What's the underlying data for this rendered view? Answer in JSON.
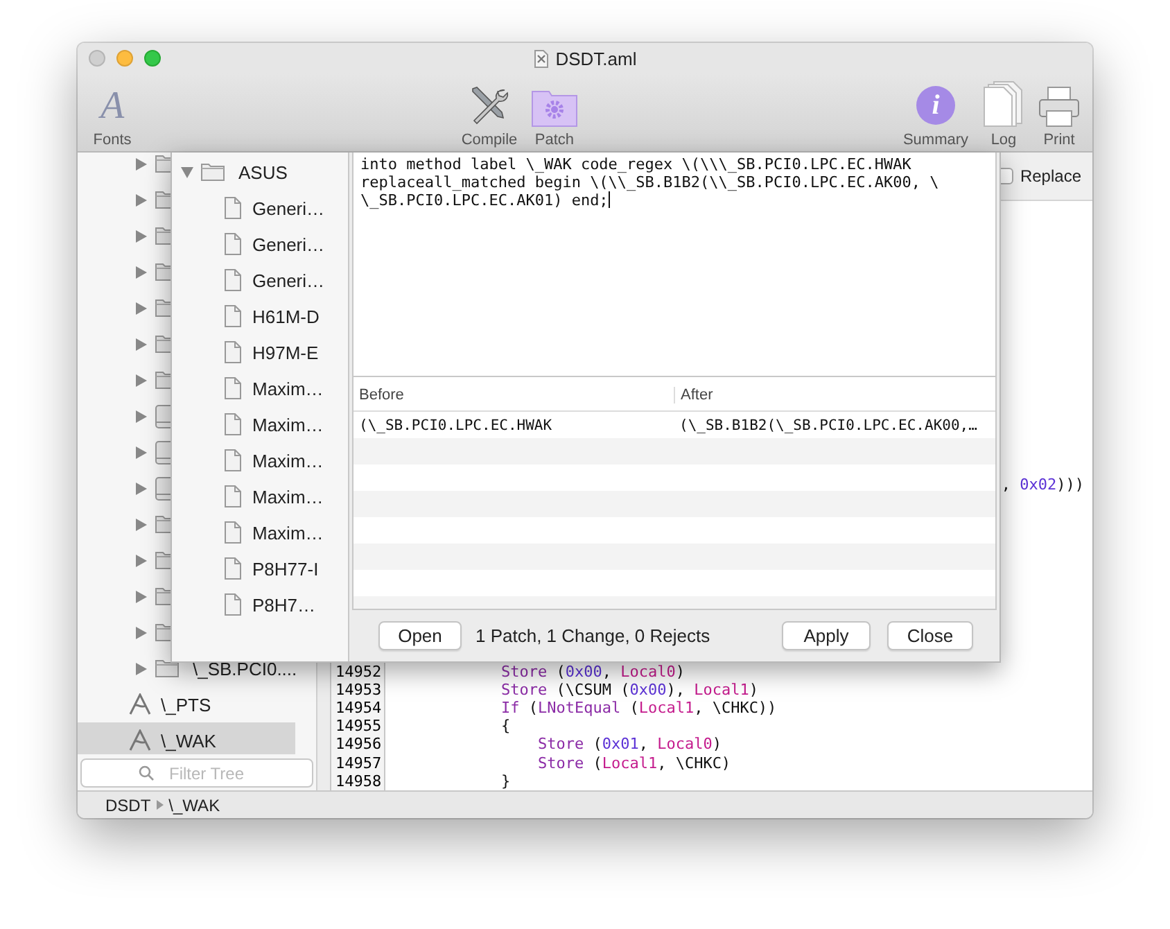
{
  "window": {
    "title": "DSDT.aml"
  },
  "toolbar": [
    {
      "label": "Fonts",
      "kind": "fonts",
      "glyph": "A"
    },
    {
      "label": "Compile",
      "kind": "compile"
    },
    {
      "label": "Patch",
      "kind": "patch"
    },
    {
      "label": "Summary",
      "kind": "summary",
      "glyph": "i"
    },
    {
      "label": "Log",
      "kind": "log"
    },
    {
      "label": "Print",
      "kind": "print"
    }
  ],
  "sidebar": {
    "items": [
      {
        "kind": "folder",
        "expanded": false,
        "selected": false
      },
      {
        "kind": "folder",
        "expanded": false,
        "selected": false
      },
      {
        "kind": "folder",
        "expanded": false,
        "selected": false
      },
      {
        "kind": "folder",
        "expanded": false,
        "selected": false
      },
      {
        "kind": "folder",
        "expanded": false,
        "selected": false
      },
      {
        "kind": "folder",
        "expanded": false,
        "selected": false
      },
      {
        "kind": "folder",
        "expanded": false,
        "selected": false
      },
      {
        "kind": "drive",
        "expanded": false,
        "selected": false
      },
      {
        "kind": "drive",
        "expanded": false,
        "selected": false
      },
      {
        "kind": "drive",
        "expanded": false,
        "selected": false
      },
      {
        "kind": "folder",
        "expanded": false,
        "selected": false
      },
      {
        "kind": "folder",
        "expanded": false,
        "selected": false
      },
      {
        "kind": "folder",
        "expanded": false,
        "selected": false
      },
      {
        "kind": "folder",
        "expanded": false,
        "selected": false
      },
      {
        "kind": "folder",
        "label": "\\_SB.PCI0....",
        "expanded": false,
        "selected": false
      },
      {
        "kind": "method",
        "label": "\\_PTS",
        "selected": false
      },
      {
        "kind": "method",
        "label": "\\_WAK",
        "selected": true
      }
    ],
    "filter": {
      "placeholder": "Filter Tree"
    }
  },
  "editor": {
    "replace": {
      "label": "Replace",
      "checked": false
    },
    "fragment": [
      {
        "text": ", ",
        "kind": "plain"
      },
      {
        "text": "0x02",
        "kind": "number"
      },
      {
        "text": ")))",
        "kind": "plain"
      }
    ],
    "lines": [
      {
        "number": "14952",
        "tokens": [
          {
            "text": "            Store",
            "kind": "keyword"
          },
          {
            "text": " (",
            "kind": "plain"
          },
          {
            "text": "0x00",
            "kind": "number"
          },
          {
            "text": ", ",
            "kind": "plain"
          },
          {
            "text": "Local0",
            "kind": "local"
          },
          {
            "text": ")",
            "kind": "plain"
          }
        ]
      },
      {
        "number": "14953",
        "tokens": [
          {
            "text": "            Store",
            "kind": "keyword"
          },
          {
            "text": " (\\CSUM (",
            "kind": "plain"
          },
          {
            "text": "0x00",
            "kind": "number"
          },
          {
            "text": "), ",
            "kind": "plain"
          },
          {
            "text": "Local1",
            "kind": "local"
          },
          {
            "text": ")",
            "kind": "plain"
          }
        ]
      },
      {
        "number": "14954",
        "tokens": [
          {
            "text": "            If",
            "kind": "keyword"
          },
          {
            "text": " (",
            "kind": "plain"
          },
          {
            "text": "LNotEqual",
            "kind": "keyword"
          },
          {
            "text": " (",
            "kind": "plain"
          },
          {
            "text": "Local1",
            "kind": "local"
          },
          {
            "text": ", \\CHKC))",
            "kind": "plain"
          }
        ]
      },
      {
        "number": "14955",
        "tokens": [
          {
            "text": "            {",
            "kind": "plain"
          }
        ]
      },
      {
        "number": "14956",
        "tokens": [
          {
            "text": "                Store",
            "kind": "keyword"
          },
          {
            "text": " (",
            "kind": "plain"
          },
          {
            "text": "0x01",
            "kind": "number"
          },
          {
            "text": ", ",
            "kind": "plain"
          },
          {
            "text": "Local0",
            "kind": "local"
          },
          {
            "text": ")",
            "kind": "plain"
          }
        ]
      },
      {
        "number": "14957",
        "tokens": [
          {
            "text": "                Store",
            "kind": "keyword"
          },
          {
            "text": " (",
            "kind": "plain"
          },
          {
            "text": "Local1",
            "kind": "local"
          },
          {
            "text": ", \\CHKC)",
            "kind": "plain"
          }
        ]
      },
      {
        "number": "14958",
        "tokens": [
          {
            "text": "            }",
            "kind": "plain"
          }
        ]
      }
    ]
  },
  "status_bar": {
    "path": [
      "DSDT",
      "\\_WAK"
    ]
  },
  "patch_sheet": {
    "library": {
      "label": "ASUS",
      "expanded": true,
      "children": [
        {
          "label": "Generi…"
        },
        {
          "label": "Generi…"
        },
        {
          "label": "Generi…"
        },
        {
          "label": "H61M-D"
        },
        {
          "label": "H97M-E"
        },
        {
          "label": "Maxim…"
        },
        {
          "label": "Maxim…"
        },
        {
          "label": "Maxim…"
        },
        {
          "label": "Maxim…"
        },
        {
          "label": "Maxim…"
        },
        {
          "label": "P8H77-I"
        },
        {
          "label": "P8H7…"
        }
      ]
    },
    "patch_text": [
      "into method label \\_WAK code_regex \\(\\\\\\_SB.PCI0.LPC.EC.HWAK",
      "replaceall_matched begin \\(\\\\_SB.B1B2(\\\\_SB.PCI0.LPC.EC.AK00, \\",
      "\\_SB.PCI0.LPC.EC.AK01) end;"
    ],
    "table": {
      "columns": [
        "Before",
        "After"
      ],
      "rows": [
        [
          "(\\_SB.PCI0.LPC.EC.HWAK",
          "(\\_SB.B1B2(\\_SB.PCI0.LPC.EC.AK00,…"
        ]
      ]
    },
    "open_button": "Open",
    "summary": "1 Patch, 1 Change, 0 Rejects",
    "apply_button": "Apply",
    "close_button": "Close"
  }
}
